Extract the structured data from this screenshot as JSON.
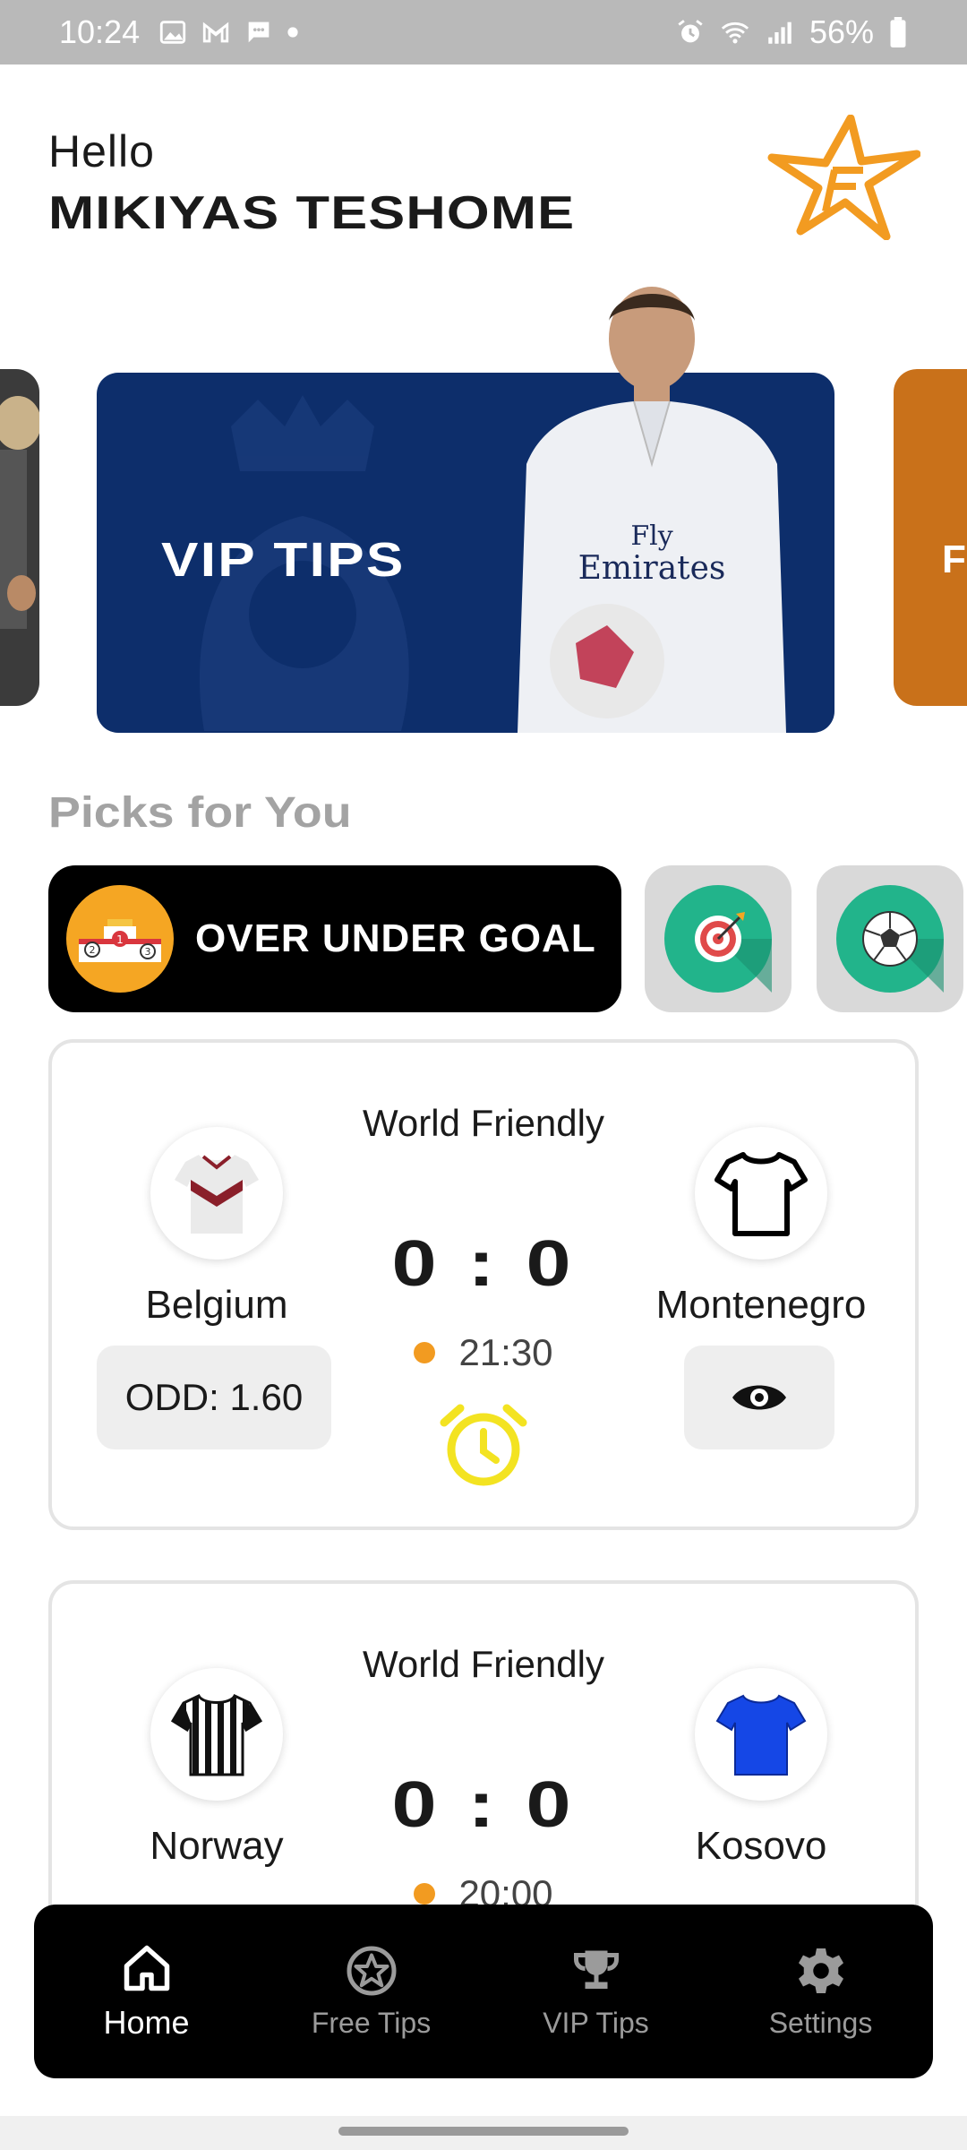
{
  "status_bar": {
    "time": "10:24",
    "battery": "56%"
  },
  "header": {
    "greeting": "Hello",
    "username": "MIKIYAS TESHOME"
  },
  "carousel": {
    "active_title": "VIP TIPS",
    "next_partial": "F"
  },
  "picks": {
    "title": "Picks for You",
    "chips": [
      {
        "label": "OVER UNDER GOAL",
        "icon": "podium-icon",
        "selected": true
      },
      {
        "label": "",
        "icon": "target-icon",
        "selected": false
      },
      {
        "label": "",
        "icon": "soccer-ball-icon",
        "selected": false
      }
    ]
  },
  "matches": [
    {
      "league": "World Friendly",
      "home": {
        "name": "Belgium",
        "jersey": "jersey-icon"
      },
      "away": {
        "name": "Montenegro",
        "jersey": "jersey-icon"
      },
      "score": "0 : 0",
      "time": "21:30",
      "odd": "ODD: 1.60"
    },
    {
      "league": "World Friendly",
      "home": {
        "name": "Norway",
        "jersey": "jersey-icon"
      },
      "away": {
        "name": "Kosovo",
        "jersey": "jersey-icon"
      },
      "score": "0 : 0",
      "time": "20:00"
    }
  ],
  "nav": [
    {
      "label": "Home",
      "icon": "home-icon",
      "active": true
    },
    {
      "label": "Free Tips",
      "icon": "star-circle-icon",
      "active": false
    },
    {
      "label": "VIP Tips",
      "icon": "trophy-icon",
      "active": false
    },
    {
      "label": "Settings",
      "icon": "gear-icon",
      "active": false
    }
  ],
  "colors": {
    "accent": "#f29b21",
    "banner": "#0d2e6b",
    "orange_card": "#c9711a",
    "chip_green": "#22b48b",
    "alarm": "#f3e321"
  }
}
